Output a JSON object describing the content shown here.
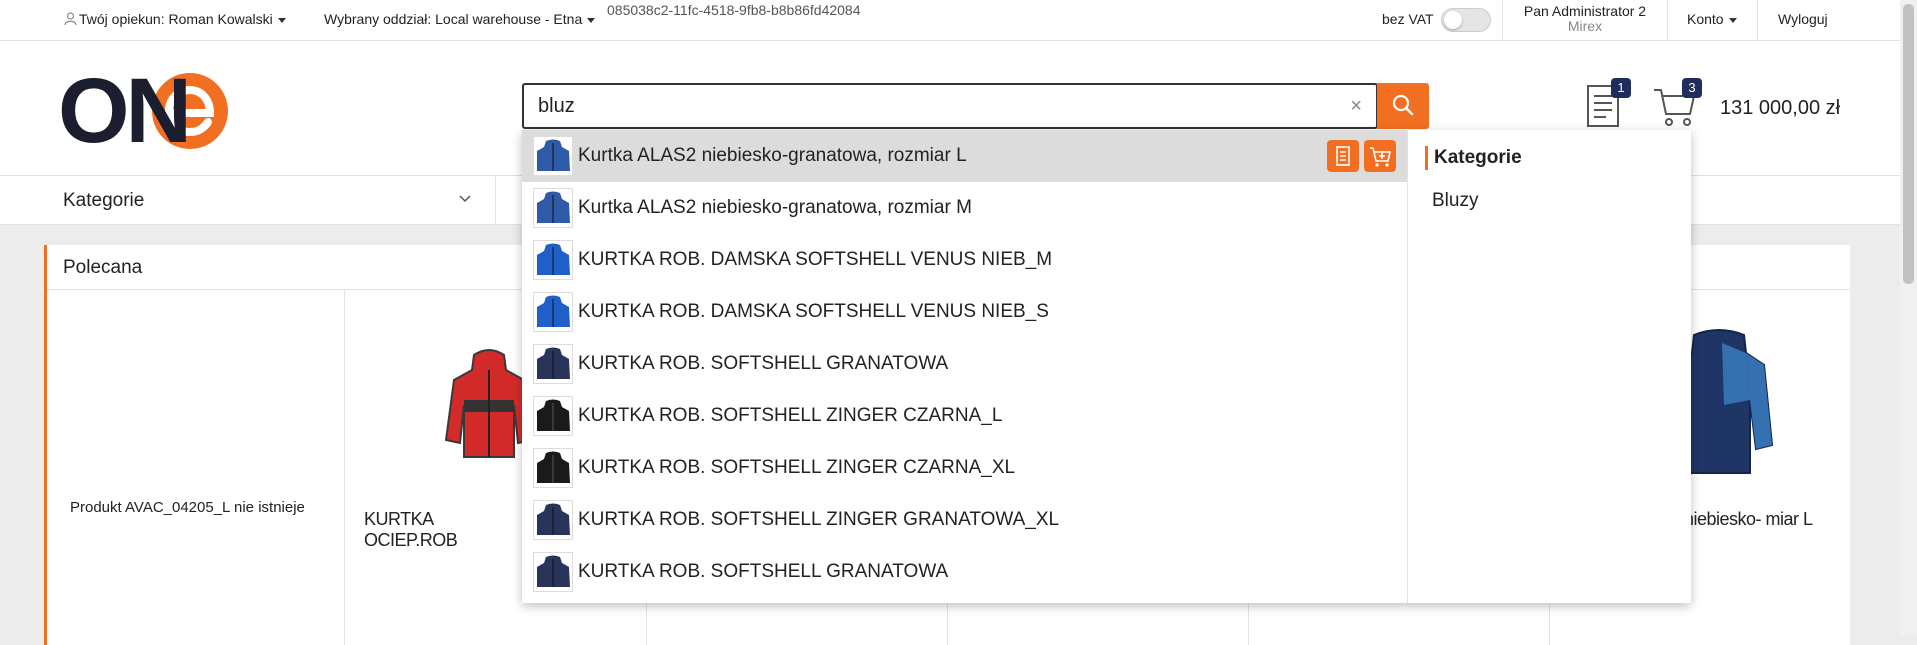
{
  "topbar": {
    "guardian": "Twój opiekun: Roman Kowalski",
    "branch": "Wybrany oddział: Local warehouse - Etna",
    "session_id": "085038c2-11fc-4518-9fb8-b8b86fd42084",
    "vat_label": "bez VAT",
    "user_name": "Pan Administrator 2",
    "user_company": "Mirex",
    "account": "Konto",
    "logout": "Wyloguj"
  },
  "header": {
    "logo_text": "ONe",
    "search_value": "bluz",
    "clear_symbol": "×",
    "documents_count": "1",
    "cart_count": "3",
    "cart_total": "131 000,00 zł"
  },
  "nav": {
    "categories": "Kategorie"
  },
  "panel": {
    "title": "Polecana",
    "missing_product": "Produkt AVAC_04205_L nie istnieje",
    "product1_name": "KURTKA OCIEP.ROB CZERWONO-CZAR",
    "product5_name": "niebiesko- miar L"
  },
  "dropdown": {
    "items": [
      {
        "name": "Kurtka ALAS2 niebiesko-granatowa, rozmiar L",
        "color": "#2f5aa8"
      },
      {
        "name": "Kurtka ALAS2 niebiesko-granatowa, rozmiar M",
        "color": "#2f5aa8"
      },
      {
        "name": "KURTKA ROB. DAMSKA SOFTSHELL VENUS NIEB_M",
        "color": "#1f5fc8"
      },
      {
        "name": "KURTKA ROB. DAMSKA SOFTSHELL VENUS NIEB_S",
        "color": "#1f5fc8"
      },
      {
        "name": "KURTKA ROB. SOFTSHELL GRANATOWA",
        "color": "#28345a"
      },
      {
        "name": "KURTKA ROB. SOFTSHELL ZINGER CZARNA_L",
        "color": "#1a1a1a"
      },
      {
        "name": "KURTKA ROB. SOFTSHELL ZINGER CZARNA_XL",
        "color": "#1a1a1a"
      },
      {
        "name": "KURTKA ROB. SOFTSHELL ZINGER GRANATOWA_XL",
        "color": "#28345a"
      },
      {
        "name": "KURTKA ROB. SOFTSHELL GRANATOWA",
        "color": "#28345a"
      }
    ],
    "categories_title": "Kategorie",
    "categories": [
      "Bluzy"
    ]
  },
  "colors": {
    "accent": "#f26f21",
    "brand_dark": "#1f2d5c"
  }
}
